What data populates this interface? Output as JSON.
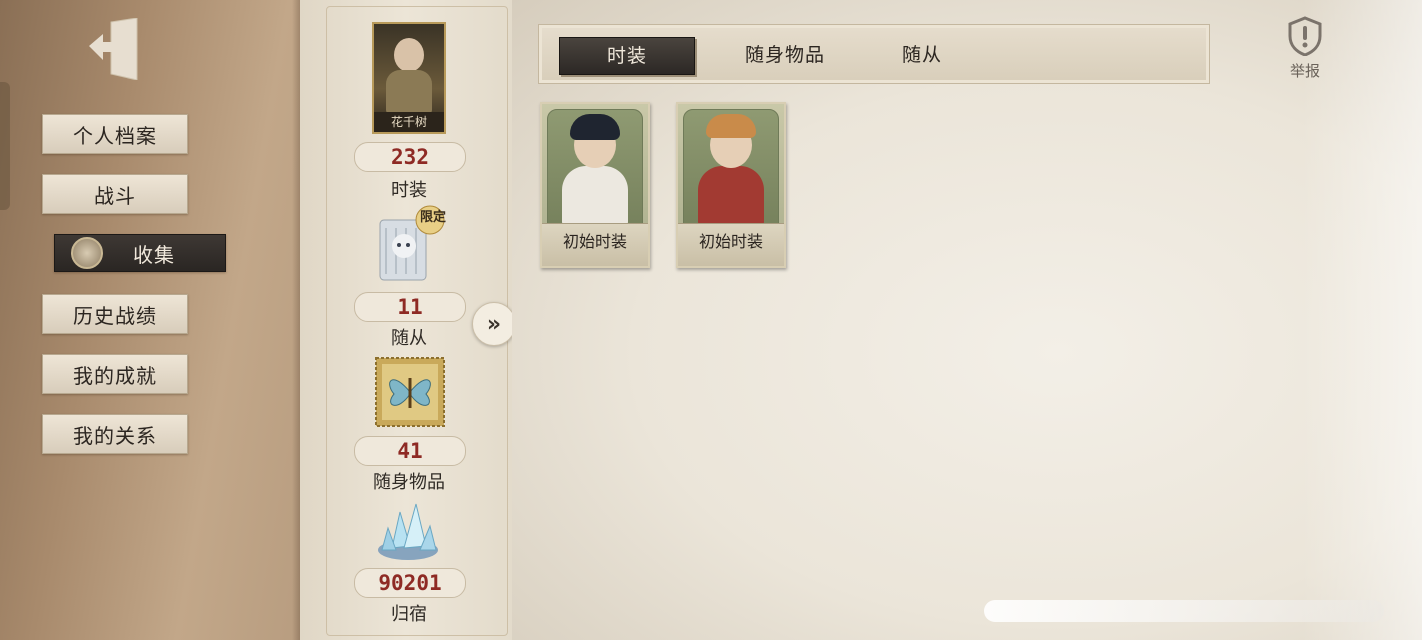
{
  "sidebar": {
    "exit_icon": "exit-door-icon",
    "items": [
      {
        "label": "个人档案"
      },
      {
        "label": "战斗"
      },
      {
        "label": "收集",
        "active": true,
        "icon": "badge-emblem-icon"
      },
      {
        "label": "历史战绩"
      },
      {
        "label": "我的成就"
      },
      {
        "label": "我的关系"
      }
    ]
  },
  "stats": {
    "portrait_name": "花千树",
    "costumes": {
      "count": "232",
      "label": "时装"
    },
    "followers": {
      "count": "11",
      "label": "随从",
      "tag": "限定"
    },
    "accessories": {
      "count": "41",
      "label": "随身物品"
    },
    "return": {
      "count": "90201",
      "label": "归宿"
    }
  },
  "tabs": [
    {
      "label": "时装",
      "active": true
    },
    {
      "label": "随身物品"
    },
    {
      "label": "随从"
    }
  ],
  "cards": [
    {
      "caption": "初始时装"
    },
    {
      "caption": "初始时装"
    }
  ],
  "report": {
    "label": "举报",
    "icon": "shield-alert-icon"
  },
  "colors": {
    "accent_red": "#8e2a24",
    "active_dark": "#2c2825"
  }
}
